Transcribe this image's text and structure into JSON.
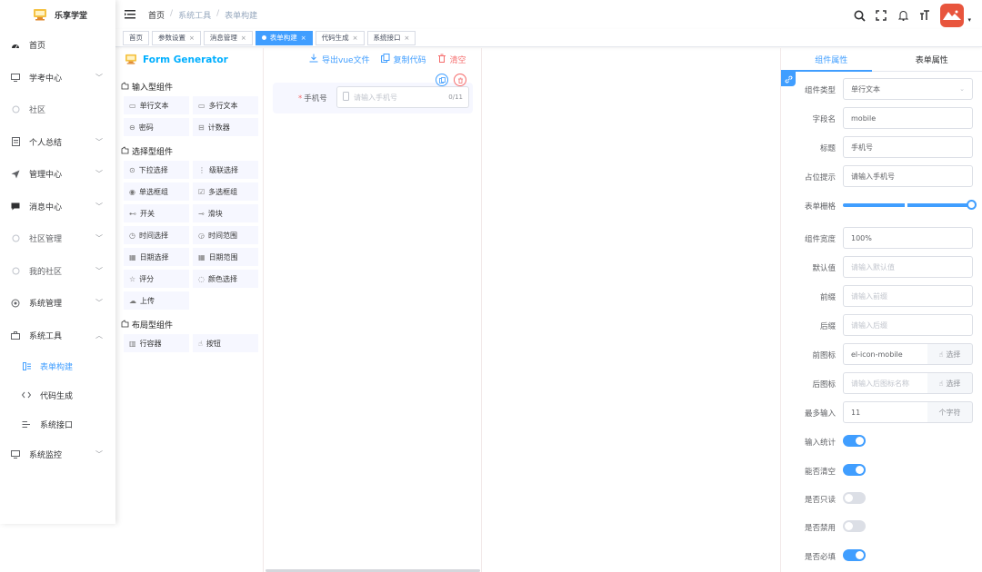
{
  "app": {
    "title": "乐享学堂"
  },
  "sidebar": {
    "items": [
      {
        "label": "首页",
        "icon": "dashboard-icon",
        "arrow": false
      },
      {
        "label": "学考中心",
        "icon": "monitor-icon",
        "arrow": true
      },
      {
        "label": "社区",
        "icon": "circle-icon",
        "arrow": false,
        "dim": true
      },
      {
        "label": "个人总结",
        "icon": "document-icon",
        "arrow": true
      },
      {
        "label": "管理中心",
        "icon": "send-icon",
        "arrow": true
      },
      {
        "label": "消息中心",
        "icon": "message-icon",
        "arrow": true
      },
      {
        "label": "社区管理",
        "icon": "circle-icon",
        "arrow": true,
        "dim": true
      },
      {
        "label": "我的社区",
        "icon": "circle-icon",
        "arrow": true,
        "dim": true
      },
      {
        "label": "系统管理",
        "icon": "settings-icon",
        "arrow": true
      },
      {
        "label": "系统工具",
        "icon": "toolbox-icon",
        "arrow": true,
        "expanded": true
      }
    ],
    "subitems": [
      {
        "label": "表单构建",
        "icon": "form-icon",
        "active": true
      },
      {
        "label": "代码生成",
        "icon": "code-icon"
      },
      {
        "label": "系统接口",
        "icon": "api-icon"
      }
    ],
    "last": {
      "label": "系统监控",
      "icon": "monitor-icon"
    }
  },
  "breadcrumb": [
    "首页",
    "系统工具",
    "表单构建"
  ],
  "tags": [
    {
      "label": "首页",
      "closable": false
    },
    {
      "label": "参数设置",
      "closable": true
    },
    {
      "label": "消息管理",
      "closable": true
    },
    {
      "label": "表单构建",
      "closable": true,
      "active": true
    },
    {
      "label": "代码生成",
      "closable": true
    },
    {
      "label": "系统接口",
      "closable": true
    }
  ],
  "generator": {
    "title": "Form Generator",
    "export_label": "导出vue文件",
    "copy_label": "复制代码",
    "clear_label": "清空"
  },
  "component_groups": [
    {
      "title": "输入型组件",
      "items": [
        {
          "label": "单行文本",
          "icon": "▭"
        },
        {
          "label": "多行文本",
          "icon": "▭"
        },
        {
          "label": "密码",
          "icon": "⊖"
        },
        {
          "label": "计数器",
          "icon": "⊟"
        }
      ]
    },
    {
      "title": "选择型组件",
      "items": [
        {
          "label": "下拉选择",
          "icon": "⊙"
        },
        {
          "label": "级联选择",
          "icon": "⋮"
        },
        {
          "label": "单选框组",
          "icon": "◉"
        },
        {
          "label": "多选框组",
          "icon": "☑"
        },
        {
          "label": "开关",
          "icon": "⊷"
        },
        {
          "label": "滑块",
          "icon": "⊸"
        },
        {
          "label": "时间选择",
          "icon": "◷"
        },
        {
          "label": "时间范围",
          "icon": "◶"
        },
        {
          "label": "日期选择",
          "icon": "▦"
        },
        {
          "label": "日期范围",
          "icon": "▦"
        },
        {
          "label": "评分",
          "icon": "☆"
        },
        {
          "label": "颜色选择",
          "icon": "◌"
        },
        {
          "label": "上传",
          "icon": "☁"
        }
      ]
    },
    {
      "title": "布局型组件",
      "items": [
        {
          "label": "行容器",
          "icon": "▥"
        },
        {
          "label": "按钮",
          "icon": "☝"
        }
      ]
    }
  ],
  "canvas": {
    "field_label": "手机号",
    "field_placeholder": "请输入手机号",
    "field_count": "0/11"
  },
  "right_tabs": [
    "组件属性",
    "表单属性"
  ],
  "props": {
    "component_type": {
      "label": "组件类型",
      "value": "单行文本"
    },
    "field_name": {
      "label": "字段名",
      "value": "mobile"
    },
    "title": {
      "label": "标题",
      "value": "手机号"
    },
    "placeholder": {
      "label": "占位提示",
      "value": "请输入手机号"
    },
    "grid": {
      "label": "表单栅格",
      "value_fraction": 1
    },
    "width": {
      "label": "组件宽度",
      "value": "100%"
    },
    "default_value": {
      "label": "默认值",
      "placeholder": "请输入默认值"
    },
    "prefix": {
      "label": "前缀",
      "placeholder": "请输入前缀"
    },
    "suffix": {
      "label": "后缀",
      "placeholder": "请输入后缀"
    },
    "prefix_icon": {
      "label": "前图标",
      "value": "el-icon-mobile",
      "button": "选择"
    },
    "suffix_icon": {
      "label": "后图标",
      "placeholder": "请输入后图标名称",
      "button": "选择"
    },
    "maxlength": {
      "label": "最多输入",
      "value": "11",
      "unit": "个字符"
    },
    "show_count": {
      "label": "输入统计",
      "on": true
    },
    "clearable": {
      "label": "能否清空",
      "on": true
    },
    "readonly": {
      "label": "是否只读",
      "on": false
    },
    "disabled": {
      "label": "是否禁用",
      "on": false
    },
    "required": {
      "label": "是否必填",
      "on": true
    }
  },
  "colors": {
    "primary": "#409eff",
    "danger": "#f56c6c",
    "brand": "#00afff"
  }
}
